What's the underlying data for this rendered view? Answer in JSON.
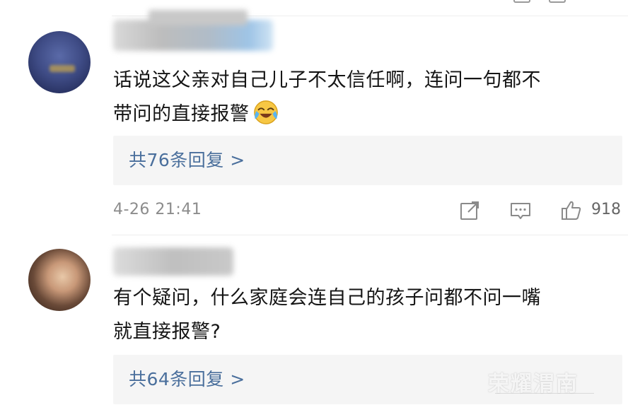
{
  "comments": [
    {
      "text_line1": "话说这父亲对自己儿子不太信任啊，连问一句都不",
      "text_line2": "带问的直接报警",
      "emoji": "laughing-crying-emoji",
      "replies_label": "共76条回复 >",
      "timestamp": "4-26 21:41",
      "like_count": "918"
    },
    {
      "text_line1": "有个疑问，什么家庭会连自己的孩子问都不问一嘴",
      "text_line2": "就直接报警?",
      "replies_label": "共64条回复 >"
    }
  ],
  "watermark": "荣耀渭南",
  "icons": {
    "share": "share-icon",
    "comment": "comment-icon",
    "like": "thumbs-up-icon"
  },
  "colors": {
    "reply_link": "#4a6f9c",
    "reply_bg": "#f5f5f5",
    "meta_text": "#8c8c8c"
  }
}
